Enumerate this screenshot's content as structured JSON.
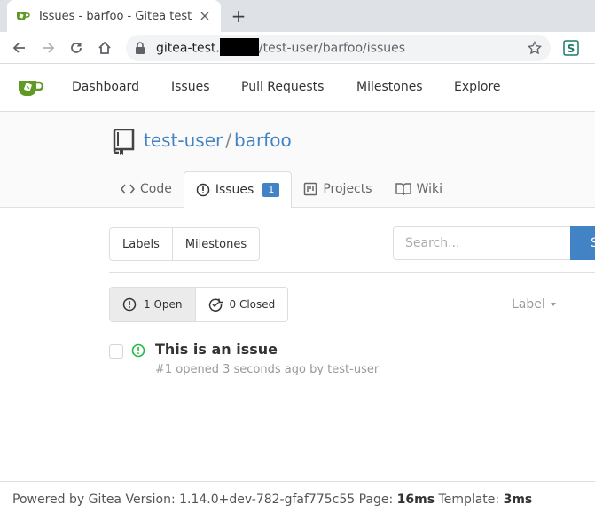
{
  "browser": {
    "tab_title": "Issues - barfoo - Gitea test",
    "url_host": "gitea-test.",
    "url_path": "/test-user/barfoo/issues",
    "extension_label": "S"
  },
  "nav": {
    "items": [
      "Dashboard",
      "Issues",
      "Pull Requests",
      "Milestones",
      "Explore"
    ]
  },
  "repo": {
    "owner": "test-user",
    "separator": "/",
    "name": "barfoo",
    "tabs": [
      {
        "label": "Code"
      },
      {
        "label": "Issues",
        "badge": "1"
      },
      {
        "label": "Projects"
      },
      {
        "label": "Wiki"
      }
    ]
  },
  "filters": {
    "labels_btn": "Labels",
    "milestones_btn": "Milestones",
    "search_placeholder": "Search...",
    "search_btn": "S",
    "open_label": "1 Open",
    "closed_label": "0 Closed",
    "label_dropdown": "Label"
  },
  "issues": [
    {
      "title": "This is an issue",
      "meta": "#1 opened 3 seconds ago by test-user"
    }
  ],
  "footer": {
    "powered": "Powered by Gitea Version: 1.14.0+dev-782-gfaf775c55 Page: ",
    "page_time": "16ms",
    "template_label": " Template: ",
    "template_time": "3ms"
  },
  "colors": {
    "link": "#4183c4",
    "open_green": "#21ba45"
  }
}
